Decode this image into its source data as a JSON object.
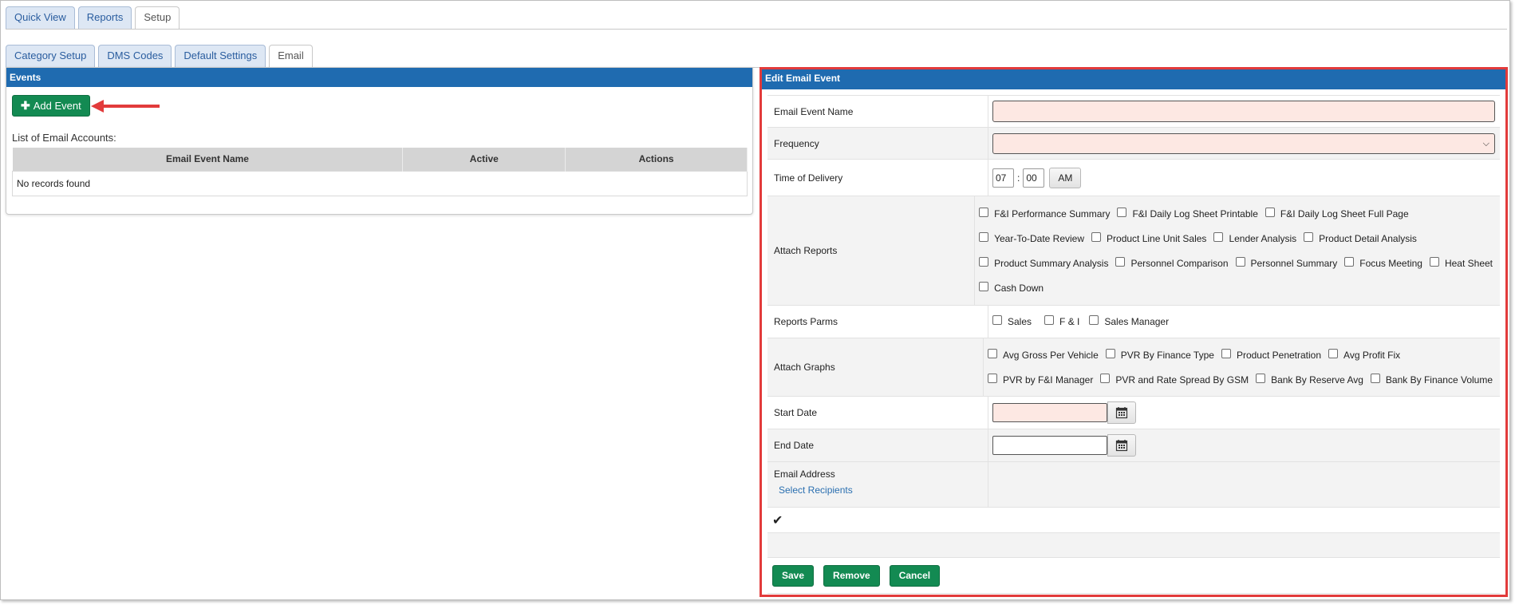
{
  "top_tabs": [
    {
      "label": "Quick View"
    },
    {
      "label": "Reports"
    },
    {
      "label": "Setup"
    }
  ],
  "sub_tabs": [
    {
      "label": "Category Setup"
    },
    {
      "label": "DMS Codes"
    },
    {
      "label": "Default Settings"
    },
    {
      "label": "Email"
    }
  ],
  "events_panel": {
    "title": "Events",
    "add_button": "Add Event",
    "list_label": "List of Email Accounts:",
    "columns": [
      "Email Event Name",
      "Active",
      "Actions"
    ],
    "empty_text": "No records found"
  },
  "edit_panel": {
    "title": "Edit Email Event",
    "labels": {
      "event_name": "Email Event Name",
      "frequency": "Frequency",
      "time_of_delivery": "Time of Delivery",
      "attach_reports": "Attach Reports",
      "reports_parms": "Reports Parms",
      "attach_graphs": "Attach Graphs",
      "start_date": "Start Date",
      "end_date": "End Date",
      "email_address": "Email Address"
    },
    "event_name_value": "",
    "frequency_value": "",
    "time": {
      "hour": "07",
      "separator": ":",
      "minute": "00",
      "ampm": "AM"
    },
    "reports_row1": [
      "F&I Performance Summary",
      "F&I Daily Log Sheet Printable",
      "F&I Daily Log Sheet Full Page"
    ],
    "reports_row2": [
      "Year-To-Date Review",
      "Product Line Unit Sales",
      "Lender Analysis",
      "Product Detail Analysis"
    ],
    "reports_row3": [
      "Product Summary Analysis",
      "Personnel Comparison",
      "Personnel Summary",
      "Focus Meeting",
      "Heat Sheet"
    ],
    "reports_row4": [
      "Cash Down"
    ],
    "parms": [
      "Sales",
      "F & I",
      "Sales Manager"
    ],
    "graphs_row1": [
      "Avg Gross Per Vehicle",
      "PVR By Finance Type",
      "Product Penetration",
      "Avg Profit Fix"
    ],
    "graphs_row2": [
      "PVR by F&I Manager",
      "PVR and Rate Spread By GSM",
      "Bank By Reserve Avg",
      "Bank By Finance Volume"
    ],
    "select_recipients": "Select Recipients",
    "check_glyph": "✔",
    "buttons": {
      "save": "Save",
      "remove": "Remove",
      "cancel": "Cancel"
    }
  },
  "colors": {
    "header_blue": "#1f6bb0",
    "button_green": "#138a52",
    "highlight_red": "#e23b3b",
    "required_pink": "#fde8e3"
  }
}
